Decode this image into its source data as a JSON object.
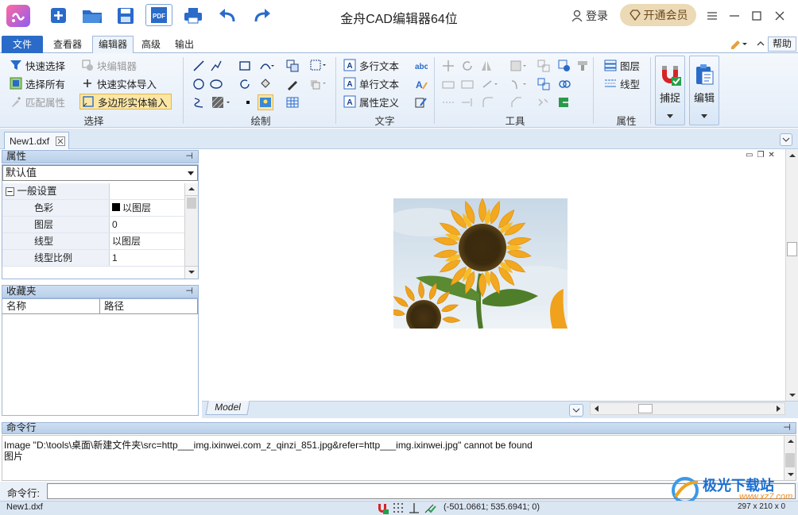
{
  "app": {
    "title": "金舟CAD编辑器64位"
  },
  "account": {
    "login": "登录",
    "vip": "开通会员"
  },
  "quick_access": [
    "new-file-icon",
    "open-folder-icon",
    "save-icon",
    "pdf-icon",
    "print-icon",
    "undo-icon",
    "redo-icon"
  ],
  "ribbon_tabs": {
    "file": "文件",
    "viewer": "查看器",
    "editor": "编辑器",
    "advanced": "高级",
    "output": "输出",
    "help": "帮助"
  },
  "ribbon": {
    "select": {
      "quick_select": "快速选择",
      "block_editor": "块编辑器",
      "select_all": "选择所有",
      "quick_import": "快速实体导入",
      "match_props": "匹配属性",
      "polygon_input": "多边形实体输入",
      "label": "选择"
    },
    "draw": {
      "label": "绘制"
    },
    "text": {
      "mtext": "多行文本",
      "stext": "单行文本",
      "attdef": "属性定义",
      "label": "文字"
    },
    "tools": {
      "label": "工具"
    },
    "props": {
      "layer": "图层",
      "linetype": "线型",
      "label": "属性"
    },
    "snap": "捕捉",
    "edit": "编辑"
  },
  "document": {
    "tab": "New1.dxf",
    "model_tab": "Model"
  },
  "properties": {
    "title": "属性",
    "selector": "默认值",
    "group": "一般设置",
    "rows": [
      {
        "key": "色彩",
        "value": "以图层"
      },
      {
        "key": "图层",
        "value": "0"
      },
      {
        "key": "线型",
        "value": "以图层"
      },
      {
        "key": "线型比例",
        "value": "1"
      }
    ]
  },
  "favorites": {
    "title": "收藏夹",
    "col_name": "名称",
    "col_path": "路径"
  },
  "command": {
    "title": "命令行",
    "lines": [
      "Image \"D:\\tools\\桌面\\新建文件夹\\src=http___img.ixinwei.com_z_qinzi_851.jpg&refer=http___img.ixinwei.jpg\" cannot be found",
      "图片"
    ],
    "prompt": "命令行:"
  },
  "status": {
    "file": "New1.dxf",
    "coords": "(-501.0661; 535.6941; 0)",
    "size": "297 x 210 x 0"
  },
  "watermark": {
    "brand": "极光下载站",
    "url": "www.xz7.com"
  },
  "colors": {
    "accent": "#2a6bc9",
    "panel_header": "#c4d7ee",
    "vip_bg": "#ecd9b6"
  }
}
